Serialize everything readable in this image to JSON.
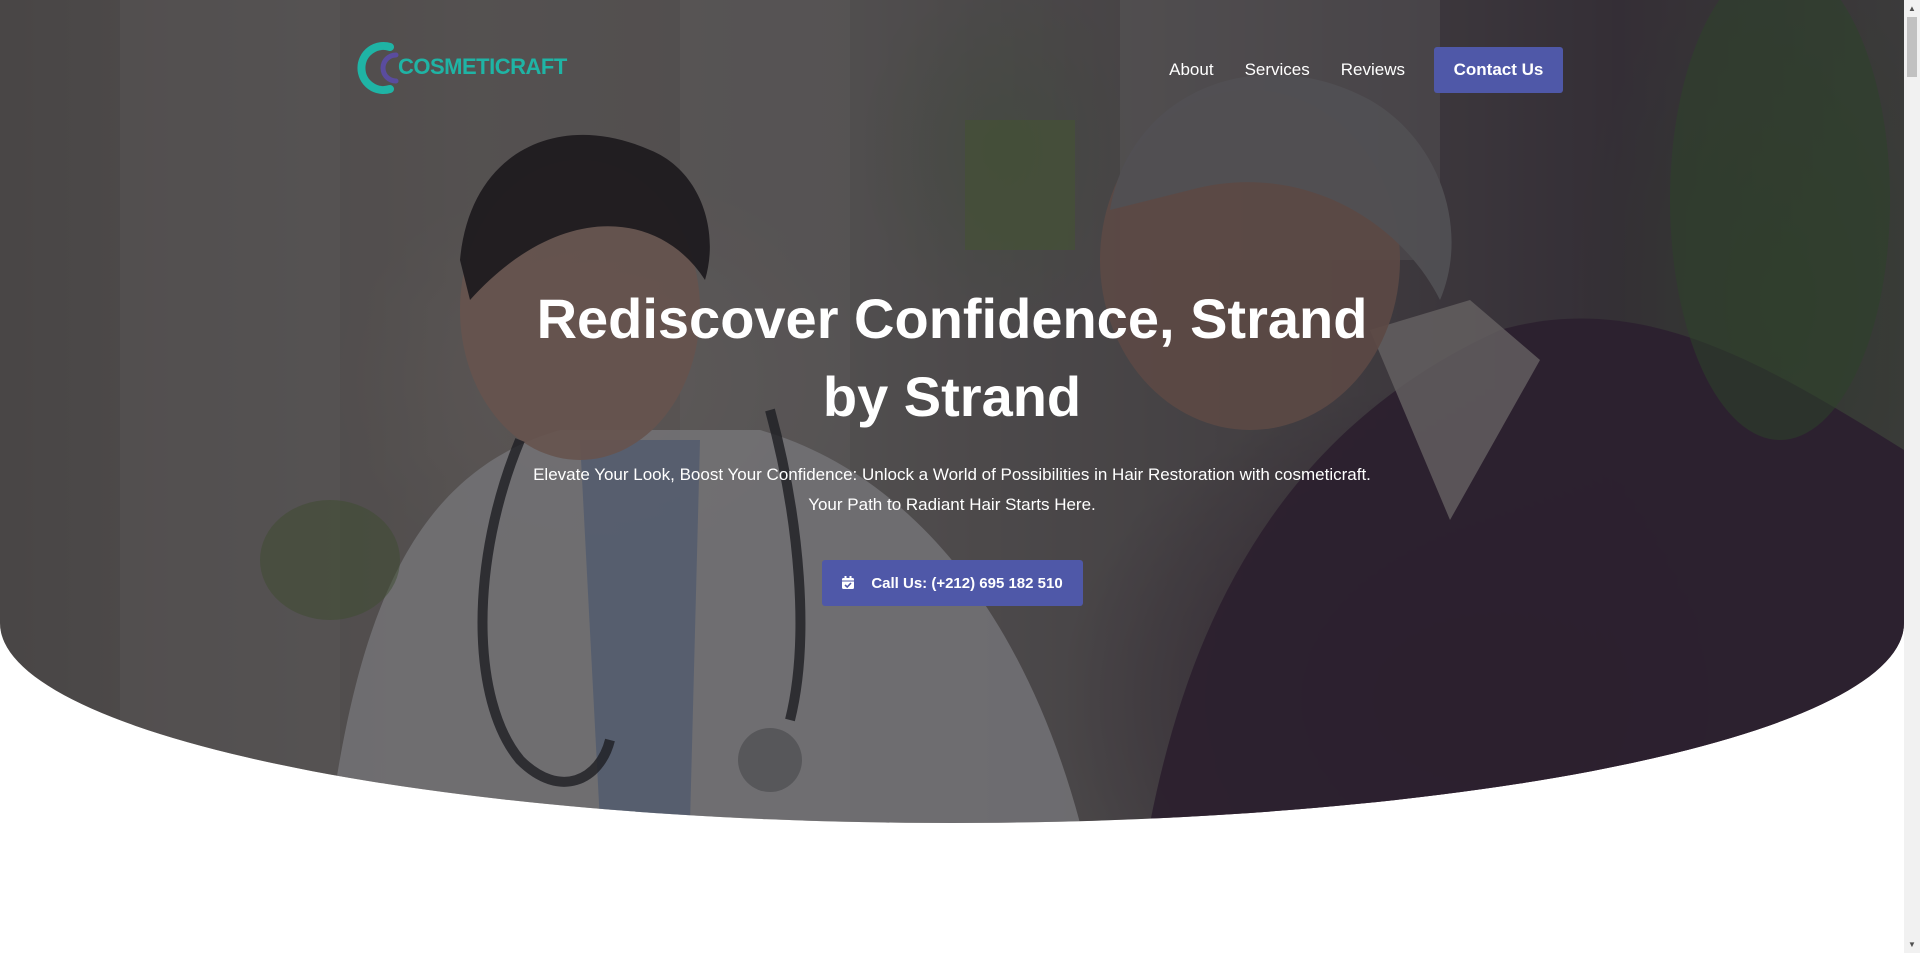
{
  "brand": {
    "name": "COSMETICRAFT",
    "primary_color": "#4f58a8",
    "logo_color": "#1fb4a5"
  },
  "nav": {
    "items": [
      {
        "label": "About"
      },
      {
        "label": "Services"
      },
      {
        "label": "Reviews"
      }
    ],
    "contact_label": "Contact Us"
  },
  "hero": {
    "title": "Rediscover Confidence, Strand by Strand",
    "subtitle": "Elevate Your Look, Boost Your Confidence: Unlock a World of Possibilities in Hair Restoration with cosmeticraft. Your Path to Radiant Hair Starts Here.",
    "cta_label": "Call Us: (+212) 695 182 510",
    "cta_icon": "calendar-check-icon"
  }
}
